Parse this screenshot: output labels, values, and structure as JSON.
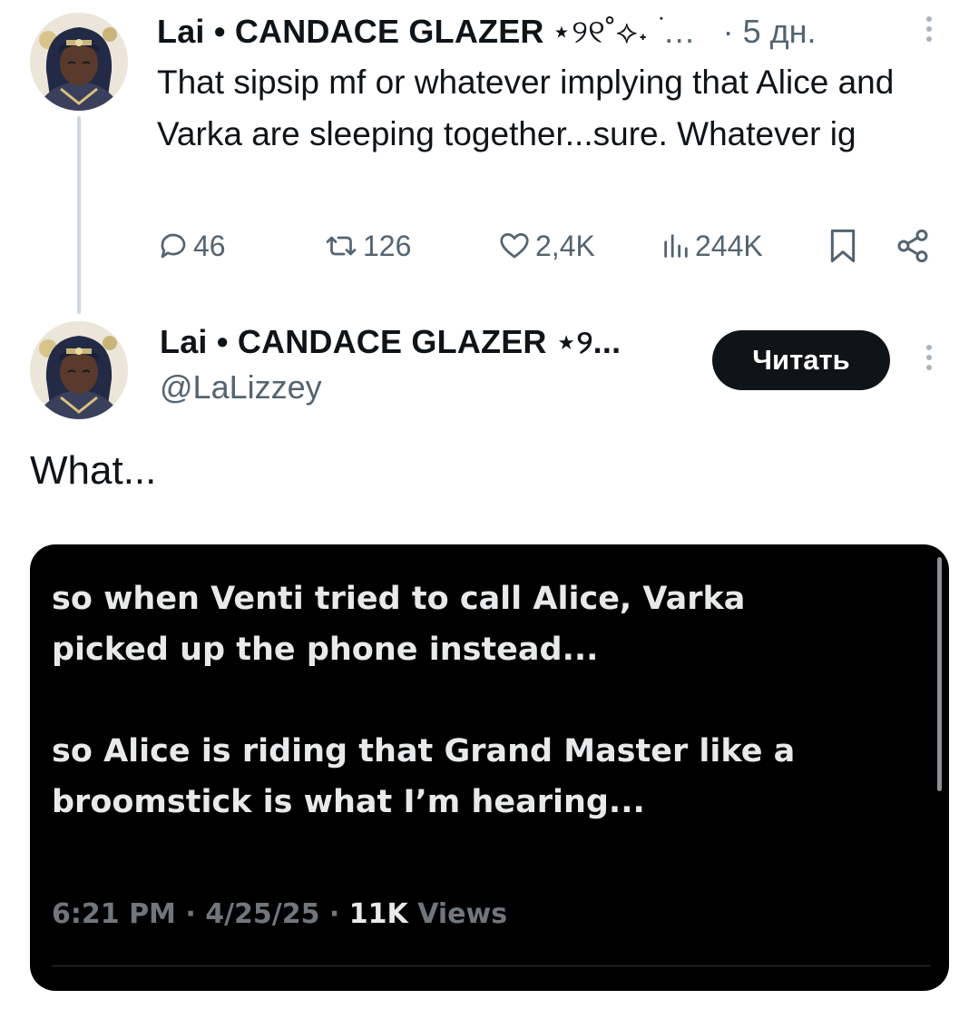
{
  "tweet1": {
    "author_name": "Lai • CANDACE GLAZER",
    "author_deco": "⋆୨୧˚⟡˖ ࣪",
    "author_ellipsis": "…",
    "time": "· 5 дн.",
    "text": "That sipsip mf or whatever implying that Alice and Varka are sleeping together...sure. Whatever ig",
    "stats": {
      "replies": "46",
      "reposts": "126",
      "likes": "2,4K",
      "views": "244K"
    }
  },
  "tweet2": {
    "author_name": "Lai • CANDACE GLAZER ⋆୨...",
    "handle": "@LaLizzey",
    "follow_label": "Читать",
    "text": "What...",
    "media": {
      "text": "so when Venti tried to call Alice, Varka\npicked up the phone instead...\n\nso Alice is riding that Grand Master like a\nbroomstick is what I’m hearing...",
      "footer_time": "6:21 PM · 4/25/25 · ",
      "footer_views_count": "11K",
      "footer_views_label": " Views"
    }
  },
  "icons": {
    "reply": "speech-bubble-icon",
    "repost": "repost-arrows-icon",
    "like": "heart-icon",
    "views": "bar-chart-icon",
    "bookmark": "bookmark-icon",
    "share": "share-icon",
    "more": "more-vertical-icon"
  },
  "colors": {
    "text": "#0f1419",
    "secondary": "#536471",
    "media_bg": "#000000",
    "follow_bg": "#0f1419"
  }
}
